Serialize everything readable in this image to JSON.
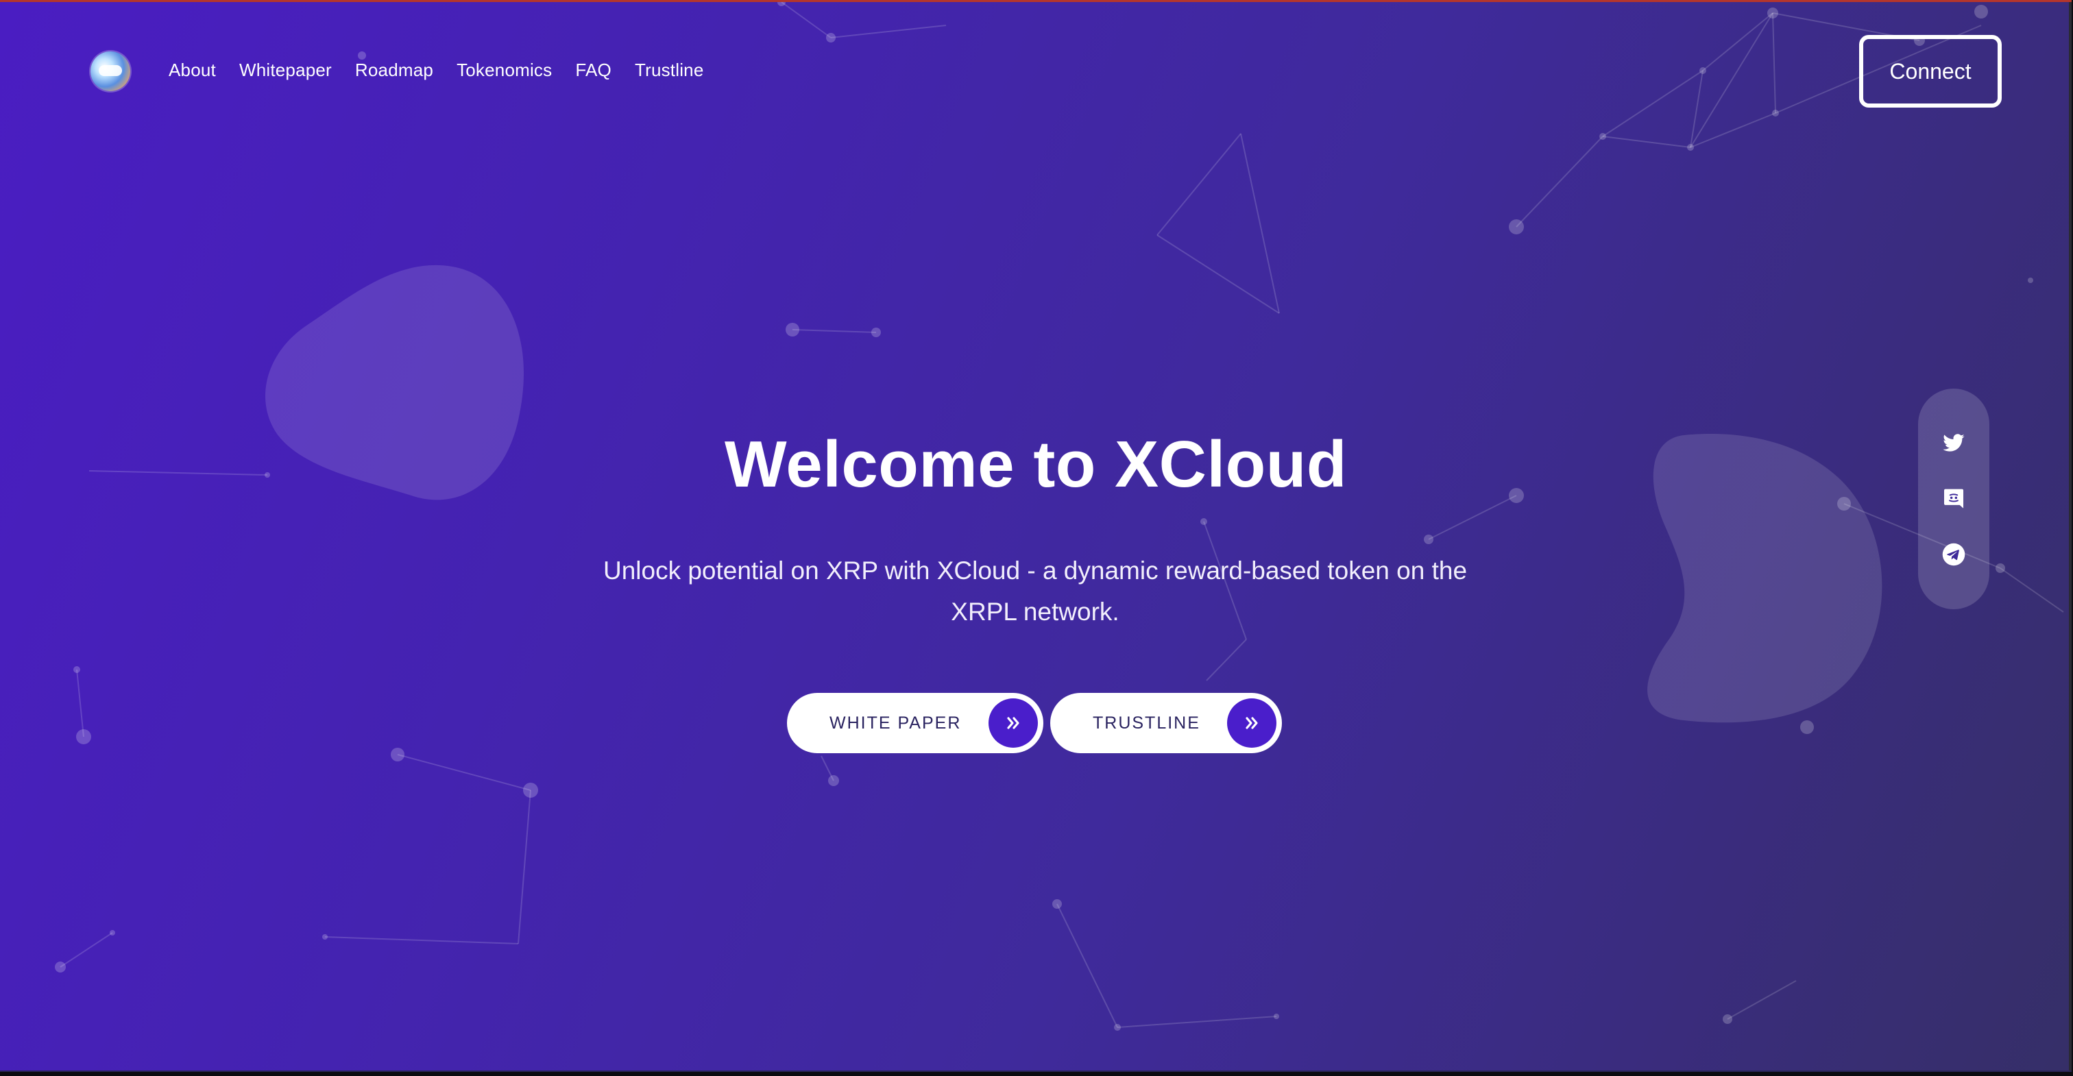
{
  "nav": {
    "logo_icon": "xcloud-logo",
    "items": [
      {
        "label": "About"
      },
      {
        "label": "Whitepaper"
      },
      {
        "label": "Roadmap"
      },
      {
        "label": "Tokenomics"
      },
      {
        "label": "FAQ"
      },
      {
        "label": "Trustline"
      }
    ],
    "connect_label": "Connect"
  },
  "hero": {
    "title": "Welcome to XCloud",
    "subtitle": "Unlock potential on XRP with XCloud - a dynamic reward-based token on the XRPL network.",
    "buttons": [
      {
        "label": "WHITE PAPER",
        "icon": "double-chevron-right-icon"
      },
      {
        "label": "TRUSTLINE",
        "icon": "double-chevron-right-icon"
      }
    ]
  },
  "social": [
    {
      "icon": "twitter-icon"
    },
    {
      "icon": "discord-icon"
    },
    {
      "icon": "telegram-icon"
    }
  ],
  "colors": {
    "gradient_start": "#4a1dc2",
    "gradient_end": "#362f68",
    "accent": "#4a1ecb",
    "text": "#ffffff",
    "button_text": "#2a2360"
  }
}
